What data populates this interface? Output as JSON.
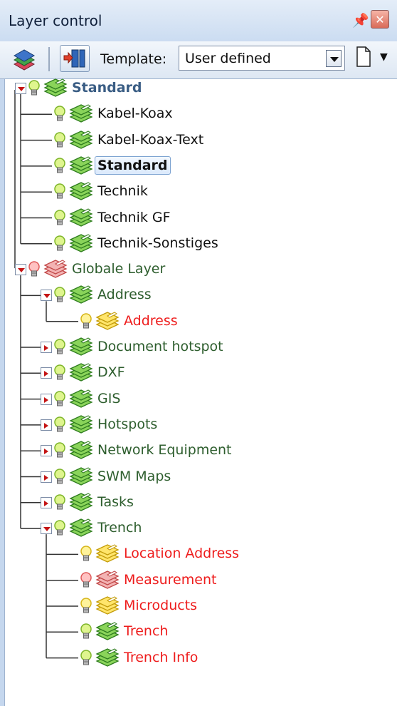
{
  "panel": {
    "title": "Layer control",
    "pin_glyph": "📌",
    "close_glyph": "✕"
  },
  "toolbar": {
    "template_label": "Template:",
    "template_value": "User defined"
  },
  "colors": {
    "group": "#2e5e2e",
    "black": "#111111",
    "red": "#ee1c1c",
    "blue_group": "#3a5d84"
  },
  "tree": [
    {
      "label": "Standard",
      "depth": 0,
      "expander": "open",
      "bulb": "green",
      "layer": "green",
      "color": "blue_group",
      "bold": true
    },
    {
      "label": "Kabel-Koax",
      "depth": 1,
      "bulb": "green",
      "layer": "green",
      "color": "black"
    },
    {
      "label": "Kabel-Koax-Text",
      "depth": 1,
      "bulb": "green",
      "layer": "green",
      "color": "black"
    },
    {
      "label": "Standard",
      "depth": 1,
      "bulb": "green",
      "layer": "green",
      "color": "black",
      "bold": true,
      "selected": true
    },
    {
      "label": "Technik",
      "depth": 1,
      "bulb": "green",
      "layer": "green",
      "color": "black"
    },
    {
      "label": "Technik GF",
      "depth": 1,
      "bulb": "green",
      "layer": "green",
      "color": "black"
    },
    {
      "label": "Technik-Sonstiges",
      "depth": 1,
      "bulb": "green",
      "layer": "green",
      "color": "black"
    },
    {
      "label": "Globale Layer",
      "depth": 0,
      "expander": "open",
      "bulb": "red",
      "layer": "red",
      "color": "group"
    },
    {
      "label": "Address",
      "depth": 1,
      "expander": "open",
      "bulb": "green",
      "layer": "green",
      "color": "group"
    },
    {
      "label": "Address",
      "depth": 2,
      "bulb": "yellow",
      "layer": "yellow",
      "color": "red"
    },
    {
      "label": "Document hotspot",
      "depth": 1,
      "expander": "closed",
      "bulb": "green",
      "layer": "green",
      "color": "group"
    },
    {
      "label": "DXF",
      "depth": 1,
      "expander": "closed",
      "bulb": "green",
      "layer": "green",
      "color": "group"
    },
    {
      "label": "GIS",
      "depth": 1,
      "expander": "closed",
      "bulb": "green",
      "layer": "green",
      "color": "group"
    },
    {
      "label": "Hotspots",
      "depth": 1,
      "expander": "closed",
      "bulb": "green",
      "layer": "green",
      "color": "group"
    },
    {
      "label": "Network Equipment",
      "depth": 1,
      "expander": "closed",
      "bulb": "green",
      "layer": "green",
      "color": "group"
    },
    {
      "label": "SWM Maps",
      "depth": 1,
      "expander": "closed",
      "bulb": "green",
      "layer": "green",
      "color": "group"
    },
    {
      "label": "Tasks",
      "depth": 1,
      "expander": "closed",
      "bulb": "green",
      "layer": "green",
      "color": "group"
    },
    {
      "label": "Trench",
      "depth": 1,
      "expander": "open",
      "bulb": "green",
      "layer": "green",
      "color": "group"
    },
    {
      "label": "Location Address",
      "depth": 2,
      "bulb": "yellow",
      "layer": "yellow",
      "color": "red"
    },
    {
      "label": "Measurement",
      "depth": 2,
      "bulb": "red",
      "layer": "red",
      "color": "red"
    },
    {
      "label": "Microducts",
      "depth": 2,
      "bulb": "yellow",
      "layer": "yellow",
      "color": "red"
    },
    {
      "label": "Trench",
      "depth": 2,
      "bulb": "green",
      "layer": "green",
      "color": "red"
    },
    {
      "label": "Trench Info",
      "depth": 2,
      "bulb": "green",
      "layer": "green",
      "color": "red"
    }
  ]
}
